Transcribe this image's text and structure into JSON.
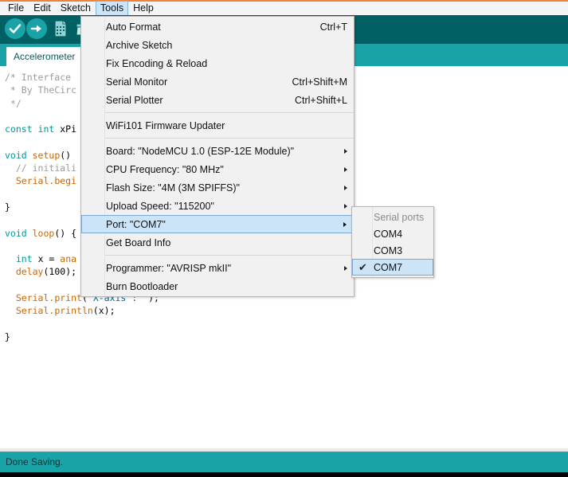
{
  "menubar": {
    "items": [
      {
        "label": "File",
        "active": false
      },
      {
        "label": "Edit",
        "active": false
      },
      {
        "label": "Sketch",
        "active": false
      },
      {
        "label": "Tools",
        "active": true
      },
      {
        "label": "Help",
        "active": false
      }
    ]
  },
  "toolbar": {
    "buttons": [
      {
        "name": "verify-button",
        "icon": "check-icon"
      },
      {
        "name": "upload-button",
        "icon": "arrow-right-icon"
      },
      {
        "name": "new-button",
        "icon": "new-document-icon"
      },
      {
        "name": "open-button",
        "icon": "open-folder-icon"
      }
    ],
    "background_color": "#006064"
  },
  "tabbar": {
    "active_tab": "Accelerometer",
    "background_color": "#1aa3a6"
  },
  "editor": {
    "lines": [
      [
        {
          "t": "/* Interface",
          "c": "comment"
        }
      ],
      [
        {
          "t": " * By TheCirc",
          "c": "comment"
        }
      ],
      [
        {
          "t": " */",
          "c": "comment"
        }
      ],
      [],
      [
        {
          "t": "const int ",
          "c": "kw"
        },
        {
          "t": "xPi",
          "c": "plain"
        }
      ],
      [],
      [
        {
          "t": "void ",
          "c": "kw"
        },
        {
          "t": "setup",
          "c": "fn"
        },
        {
          "t": "()",
          "c": "plain"
        }
      ],
      [
        {
          "t": "  ",
          "c": "plain"
        },
        {
          "t": "// initiali",
          "c": "comment"
        }
      ],
      [
        {
          "t": "  ",
          "c": "plain"
        },
        {
          "t": "Serial",
          "c": "fn"
        },
        {
          "t": ".begi",
          "c": "fn"
        }
      ],
      [],
      [
        {
          "t": "}",
          "c": "plain"
        }
      ],
      [],
      [
        {
          "t": "void ",
          "c": "kw"
        },
        {
          "t": "loop",
          "c": "fn"
        },
        {
          "t": "() {",
          "c": "plain"
        }
      ],
      [],
      [
        {
          "t": "  ",
          "c": "plain"
        },
        {
          "t": "int ",
          "c": "kw"
        },
        {
          "t": "x = ",
          "c": "plain"
        },
        {
          "t": "ana",
          "c": "fn"
        }
      ],
      [
        {
          "t": "  ",
          "c": "plain"
        },
        {
          "t": "delay",
          "c": "fn"
        },
        {
          "t": "(",
          "c": "plain"
        },
        {
          "t": "100",
          "c": "num"
        },
        {
          "t": ");",
          "c": "plain"
        }
      ],
      [],
      [
        {
          "t": "  ",
          "c": "plain"
        },
        {
          "t": "Serial",
          "c": "fn"
        },
        {
          "t": ".print",
          "c": "fn"
        },
        {
          "t": "(",
          "c": "plain"
        },
        {
          "t": "\"X-axis : \"",
          "c": "str"
        },
        {
          "t": ");",
          "c": "plain"
        }
      ],
      [
        {
          "t": "  ",
          "c": "plain"
        },
        {
          "t": "Serial",
          "c": "fn"
        },
        {
          "t": ".println",
          "c": "fn"
        },
        {
          "t": "(",
          "c": "plain"
        },
        {
          "t": "x",
          "c": "plain"
        },
        {
          "t": ");",
          "c": "plain"
        }
      ],
      [],
      [
        {
          "t": "}",
          "c": "plain"
        }
      ]
    ]
  },
  "tools_menu": {
    "items": [
      {
        "label": "Auto Format",
        "accel": "Ctrl+T",
        "arrow": false,
        "selected": false
      },
      {
        "label": "Archive Sketch",
        "accel": "",
        "arrow": false,
        "selected": false
      },
      {
        "label": "Fix Encoding & Reload",
        "accel": "",
        "arrow": false,
        "selected": false
      },
      {
        "label": "Serial Monitor",
        "accel": "Ctrl+Shift+M",
        "arrow": false,
        "selected": false
      },
      {
        "label": "Serial Plotter",
        "accel": "Ctrl+Shift+L",
        "arrow": false,
        "selected": false
      },
      {
        "separator": true
      },
      {
        "label": "WiFi101 Firmware Updater",
        "accel": "",
        "arrow": false,
        "selected": false
      },
      {
        "separator": true
      },
      {
        "label": "Board: \"NodeMCU 1.0 (ESP-12E Module)\"",
        "accel": "",
        "arrow": true,
        "selected": false
      },
      {
        "label": "CPU Frequency: \"80 MHz\"",
        "accel": "",
        "arrow": true,
        "selected": false
      },
      {
        "label": "Flash Size: \"4M (3M SPIFFS)\"",
        "accel": "",
        "arrow": true,
        "selected": false
      },
      {
        "label": "Upload Speed: \"115200\"",
        "accel": "",
        "arrow": true,
        "selected": false
      },
      {
        "label": "Port: \"COM7\"",
        "accel": "",
        "arrow": true,
        "selected": true
      },
      {
        "label": "Get Board Info",
        "accel": "",
        "arrow": false,
        "selected": false
      },
      {
        "separator": true
      },
      {
        "label": "Programmer: \"AVRISP mkII\"",
        "accel": "",
        "arrow": true,
        "selected": false
      },
      {
        "label": "Burn Bootloader",
        "accel": "",
        "arrow": false,
        "selected": false
      }
    ]
  },
  "port_submenu": {
    "header": "Serial ports",
    "items": [
      {
        "label": "COM4",
        "checked": false
      },
      {
        "label": "COM3",
        "checked": false
      },
      {
        "label": "COM7",
        "checked": true
      }
    ],
    "check_glyph": "✔"
  },
  "statusbar": {
    "message": "Done Saving.",
    "background_color": "#1aa3a6"
  }
}
